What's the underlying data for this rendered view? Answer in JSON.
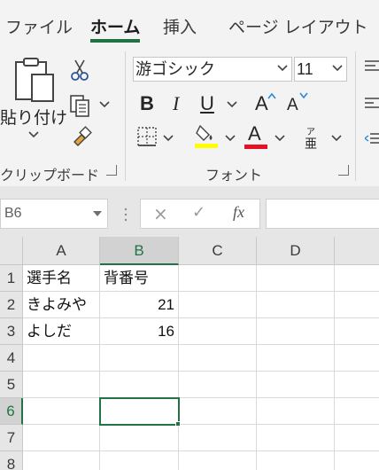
{
  "tabs": [
    {
      "label": "ファイル",
      "active": false
    },
    {
      "label": "ホーム",
      "active": true
    },
    {
      "label": "挿入",
      "active": false
    },
    {
      "label": "ページ レイアウト",
      "active": false
    }
  ],
  "ribbon": {
    "clipboard": {
      "paste_label": "貼り付け",
      "group_label": "クリップボード",
      "icons": [
        "paste-icon",
        "cut-icon",
        "copy-icon",
        "format-painter-icon"
      ]
    },
    "font": {
      "font_name": "游ゴシック",
      "font_size": "11",
      "bold": "B",
      "italic": "I",
      "underline": "U",
      "grow": "A",
      "shrink": "A",
      "font_color_letter": "A",
      "phonetic_top": "ア",
      "phonetic_bottom": "亜",
      "group_label": "フォント",
      "fill_color": "#ffff00",
      "font_color": "#e81123",
      "icons": [
        "borders-icon",
        "fill-color-icon",
        "font-color-icon",
        "phonetic-guide-icon"
      ]
    }
  },
  "formula_bar": {
    "name_box": "B6",
    "cancel_icon": "×",
    "enter_icon": "✓",
    "function_label": "fx",
    "value": ""
  },
  "sheet": {
    "columns": [
      "A",
      "B",
      "C",
      "D"
    ],
    "rows": [
      "1",
      "2",
      "3",
      "4",
      "5",
      "6",
      "7",
      "8"
    ],
    "cells": {
      "A1": "選手名",
      "B1": "背番号",
      "A2": "きよみや",
      "B2": "21",
      "A3": "よしだ",
      "B3": "16"
    },
    "active_cell": "B6",
    "accent_color": "#217346"
  }
}
